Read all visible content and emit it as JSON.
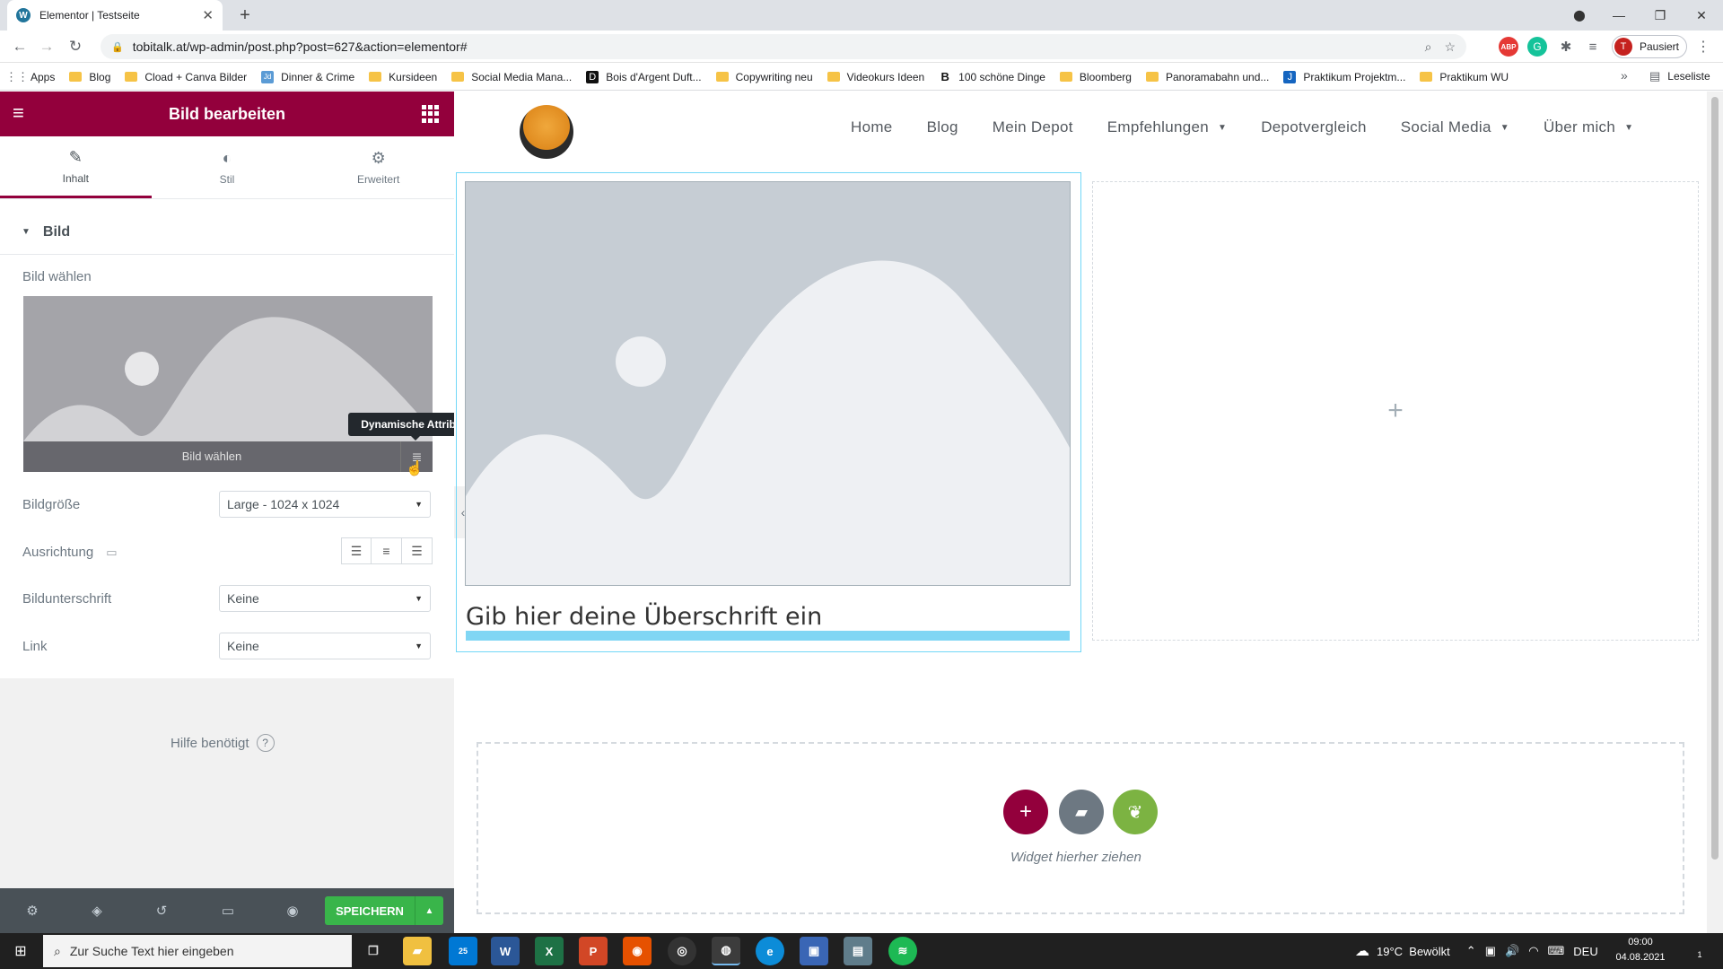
{
  "browser": {
    "tab_title": "Elementor | Testseite",
    "url": "tobitalk.at/wp-admin/post.php?post=627&action=elementor#",
    "profile_initial": "T",
    "profile_label": "Pausiert",
    "ext_adblock": "ABP",
    "bookmarks": [
      {
        "label": "Apps",
        "kind": "apps"
      },
      {
        "label": "Blog",
        "kind": "folder"
      },
      {
        "label": "Cload + Canva Bilder",
        "kind": "folder"
      },
      {
        "label": "Dinner & Crime",
        "kind": "site"
      },
      {
        "label": "Kursideen",
        "kind": "folder"
      },
      {
        "label": "Social Media Mana...",
        "kind": "folder"
      },
      {
        "label": "Bois d'Argent Duft...",
        "kind": "site"
      },
      {
        "label": "Copywriting neu",
        "kind": "folder"
      },
      {
        "label": "Videokurs Ideen",
        "kind": "folder"
      },
      {
        "label": "100 schöne Dinge",
        "kind": "site"
      },
      {
        "label": "Bloomberg",
        "kind": "folder"
      },
      {
        "label": "Panoramabahn und...",
        "kind": "folder"
      },
      {
        "label": "Praktikum Projektm...",
        "kind": "site"
      },
      {
        "label": "Praktikum WU",
        "kind": "folder"
      }
    ],
    "bookmarks_more": "»",
    "reading_list": "Leseliste",
    "bm_badges": {
      "dinner": "Jd",
      "bois": "D",
      "schoene": "B",
      "praktikum": "J"
    }
  },
  "panel": {
    "title": "Bild bearbeiten",
    "tabs": [
      {
        "label": "Inhalt",
        "icon": "pencil-icon"
      },
      {
        "label": "Stil",
        "icon": "contrast-icon"
      },
      {
        "label": "Erweitert",
        "icon": "gear-icon"
      }
    ],
    "section_title": "Bild",
    "choose_image_label": "Bild wählen",
    "choose_image_button": "Bild wählen",
    "tooltip": "Dynamische Attribute",
    "fields": {
      "size_label": "Bildgröße",
      "size_value": "Large - 1024 x 1024",
      "align_label": "Ausrichtung",
      "caption_label": "Bildunterschrift",
      "caption_value": "Keine",
      "link_label": "Link",
      "link_value": "Keine"
    },
    "help": "Hilfe benötigt",
    "save": "SPEICHERN"
  },
  "page": {
    "nav": [
      {
        "label": "Home",
        "dropdown": false
      },
      {
        "label": "Blog",
        "dropdown": false
      },
      {
        "label": "Mein Depot",
        "dropdown": false
      },
      {
        "label": "Empfehlungen",
        "dropdown": true
      },
      {
        "label": "Depotvergleich",
        "dropdown": false
      },
      {
        "label": "Social Media",
        "dropdown": true
      },
      {
        "label": "Über mich",
        "dropdown": true
      }
    ],
    "heading": "Gib hier deine Überschrift ein",
    "drop_text": "Widget hierher ziehen"
  },
  "taskbar": {
    "search_placeholder": "Zur Suche Text hier eingeben",
    "badge": "25",
    "weather": "19°C  Bewölkt",
    "lang": "DEU",
    "time": "09:00",
    "date": "04.08.2021",
    "notif_count": "1"
  },
  "colors": {
    "elementor_maroon": "#93003c",
    "save_green": "#39b54a",
    "column_border": "#71d7f7",
    "kit_green": "#7cb342"
  }
}
